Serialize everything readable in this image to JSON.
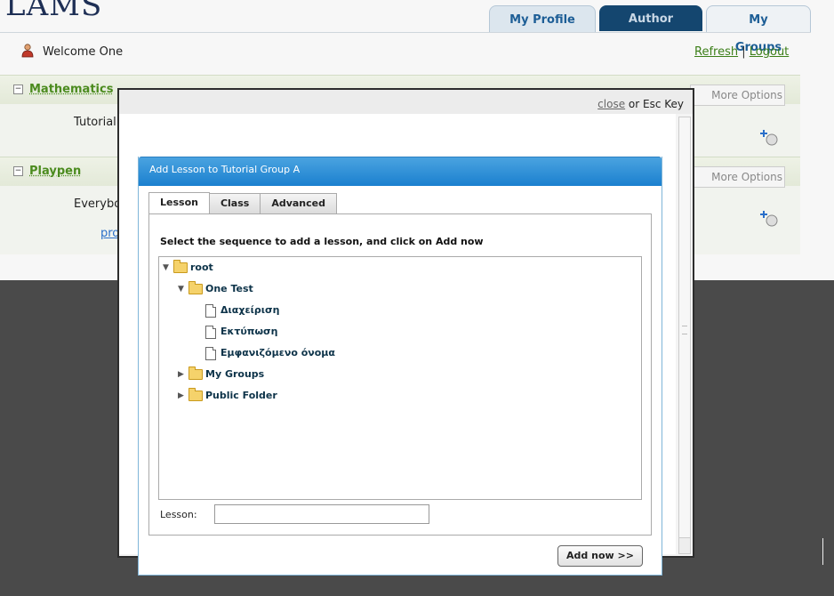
{
  "app": {
    "logo_text": "LAMS"
  },
  "top_tabs": [
    {
      "label": "My Profile"
    },
    {
      "label": "Author"
    },
    {
      "label": "My Groups"
    }
  ],
  "userbar": {
    "welcome": "Welcome One",
    "refresh": "Refresh",
    "separator": "|",
    "logout": "Logout"
  },
  "groups": [
    {
      "title": "Mathematics",
      "subgroup": "Tutorial",
      "more_options": "More Options"
    },
    {
      "title": "Playpen",
      "subgroup": "Everybo",
      "link": "pro",
      "more_options": "More Options"
    }
  ],
  "modal": {
    "close_link": "close",
    "close_suffix": " or Esc Key",
    "title": "Add Lesson to Tutorial Group A",
    "tabs": [
      {
        "label": "Lesson",
        "active": true
      },
      {
        "label": "Class",
        "active": false
      },
      {
        "label": "Advanced",
        "active": false
      }
    ],
    "instruction": "Select the sequence to add a lesson, and click on Add now",
    "tree": {
      "root": "root",
      "folder_one_test": "One Test",
      "lessons": [
        "Διαχείριση",
        "Εκτύπωση",
        "Εμφανιζόμενο όνομα"
      ],
      "folder_my_groups": "My Groups",
      "folder_public": "Public Folder"
    },
    "lesson_label": "Lesson:",
    "lesson_value": "",
    "add_button": "Add now >>"
  },
  "colors": {
    "accent_blue": "#1b80cf",
    "group_green": "#4b8b1e",
    "overlay": "#4a4a4a"
  }
}
